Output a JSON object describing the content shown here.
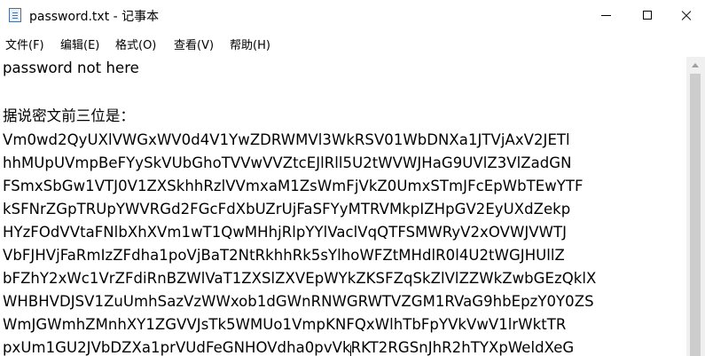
{
  "window": {
    "title": "password.txt - 记事本"
  },
  "menu": [
    "文件(F)",
    "编辑(E)",
    "格式(O)",
    "查看(V)",
    "帮助(H)"
  ],
  "editor": {
    "lines": [
      "password not here",
      "",
      "据说密文前三位是：",
      "Vm0wd2QyUXlVWGxWV0d4V1YwZDRWMVl3WkRSV01WbDNXa1JTVjAxV2JETl",
      "hhMUpUVmpBeFYySkVUbGhoTVVwVVZtcEJlRll5U2tWVWJHaG9UVlZ3VlZadGN",
      "FSmxSbGw1VTJ0V1ZXSkhhRzlVVmxaM1ZsWmFjVkZ0UmxSTmJFcEpWbTEwYTF",
      "kSFNrZGpTRUpYWVRGd2FGcFdXbUZrUjFaSFYyMTRVMkpIZHpGV2EyUXdZekp",
      "HYzFOdVVtaFNlbXhXVm1wT1QwMHhjRlpYYlVaclVqQTFSMWRyV2xOVWJVWTJ",
      "VbFJHVjFaRmIzZFdha1poVjBaT2NtRkhhRk5sYlhoWFZtMHdlR0l4U2tWGJHUllZ",
      "bFZhY2xWc1VrZFdiRnBZWlVaT1ZXSlZXVEpWYkZKSFZqSkZlVlZZWkZwbGEzQklX",
      "WHBHVDJSV1ZuUmhSazVzWWxob1dGWnRNWGRWTVZGM1RVaG9hbEpzY0Y0ZS",
      "WmJGWmhZMnhXY1ZGVVJsTk5WMUo1VmpKNFQxWlhTbFpYVkVwV1lrWktTR",
      "pxUm1GU2JVbDZXa1prVUdFeGNHOVdha0pvVkRKT2RGSnJhR2hTYXpWeldXeG"
    ]
  }
}
